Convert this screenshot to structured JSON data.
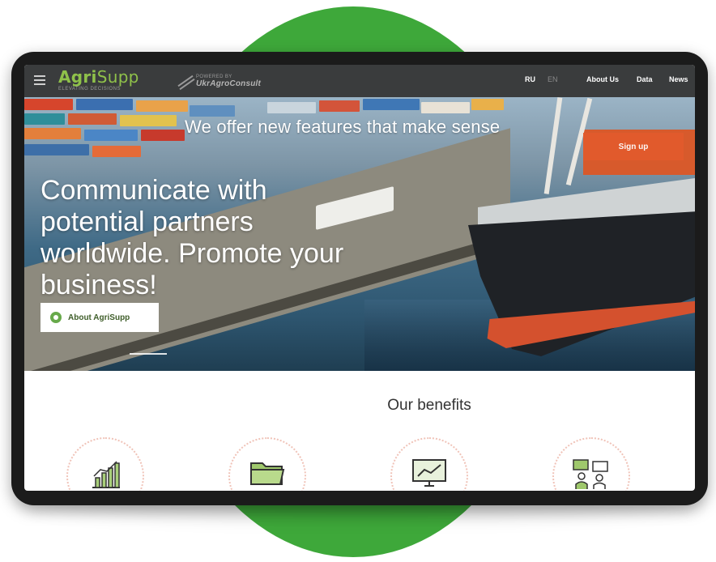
{
  "brand": {
    "logo_prefix": "Agri",
    "logo_suffix": "Supp",
    "logo_tagline": "ELEVATING DECISIONS",
    "powered_by_label": "POWERED BY",
    "powered_by_name": "UkrAgroConsult"
  },
  "nav": {
    "lang_ru": "RU",
    "lang_en": "EN",
    "links": [
      "About Us",
      "Data",
      "News"
    ]
  },
  "hero": {
    "tagline": "We offer new features that make sense",
    "signup_label": "Sign up",
    "title_lines": [
      "Communicate with",
      "potential partners",
      "worldwide. Promote your",
      "business!"
    ],
    "about_label": "About AgriSupp"
  },
  "benefits": {
    "title": "Our benefits",
    "icons": [
      "growth-chart-icon",
      "folder-icon",
      "monitor-chart-icon",
      "consulting-people-icon"
    ]
  },
  "colors": {
    "accent_green": "#8fc14a",
    "background_circle": "#3ea83a",
    "signup_orange": "#e25a2c",
    "navbar": "#3a3c3d"
  }
}
